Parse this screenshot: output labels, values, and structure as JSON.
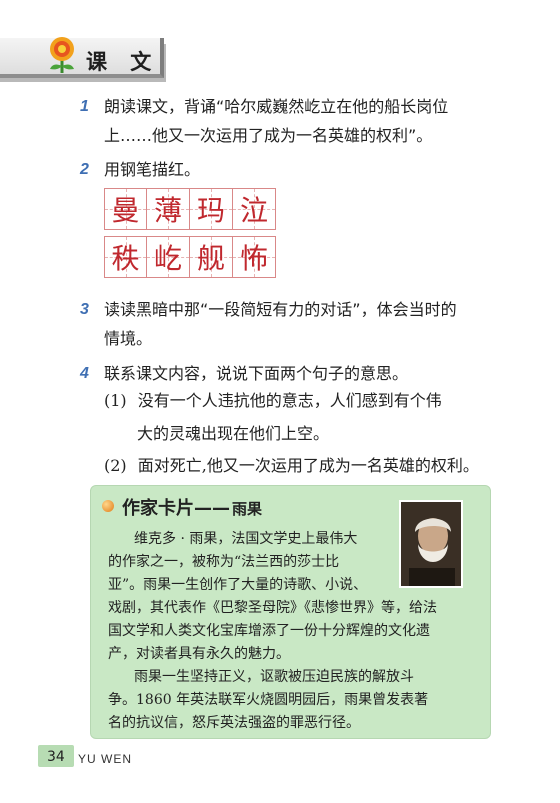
{
  "header": {
    "title": "课 文"
  },
  "items": [
    {
      "num": "1",
      "lines": [
        "朗读课文，背诵“哈尔威巍然屹立在他的船长岗位",
        "上……他又一次运用了成为一名英雄的权利”。"
      ]
    },
    {
      "num": "2",
      "lines": [
        "用钢笔描红。"
      ]
    },
    {
      "num": "3",
      "lines": [
        "读读黑暗中那“一段简短有力的对话”，体会当时的",
        "情境。"
      ]
    },
    {
      "num": "4",
      "lines": [
        "联系课文内容，说说下面两个句子的意思。"
      ]
    }
  ],
  "practice_chars": {
    "row1": [
      "曼",
      "薄",
      "玛",
      "泣"
    ],
    "row2": [
      "秩",
      "屹",
      "舰",
      "怖"
    ]
  },
  "sentences": [
    {
      "label": "(1)",
      "lines": [
        "没有一个人违抗他的意志，人们感到有个伟",
        "大的灵魂出现在他们上空。"
      ]
    },
    {
      "label": "(2)",
      "lines": [
        "面对死亡,他又一次运用了成为一名英雄的权利。"
      ]
    }
  ],
  "card": {
    "title": "作家卡片——",
    "author": "雨果",
    "lines": [
      "维克多 · 雨果，法国文学史上最伟大",
      "的作家之一，被称为“法兰西的莎士比",
      "亚”。雨果一生创作了大量的诗歌、小说、",
      "戏剧，其代表作《巴黎圣母院》《悲惨世界》等，给法",
      "国文学和人类文化宝库增添了一份十分辉煌的文化遗",
      "产，对读者具有永久的魅力。",
      "雨果一生坚持正义，讴歌被压迫民族的解放斗",
      "争。1860 年英法联军火烧圆明园后，雨果曾发表著",
      "名的抗议信，怒斥英法强盗的罪恶行径。"
    ]
  },
  "footer": {
    "page": "34",
    "text": "YU WEN"
  },
  "colors": {
    "item_number": "#3f6fb3",
    "practice_char": "#c0282e",
    "card_bg": "#c9e8c5"
  }
}
